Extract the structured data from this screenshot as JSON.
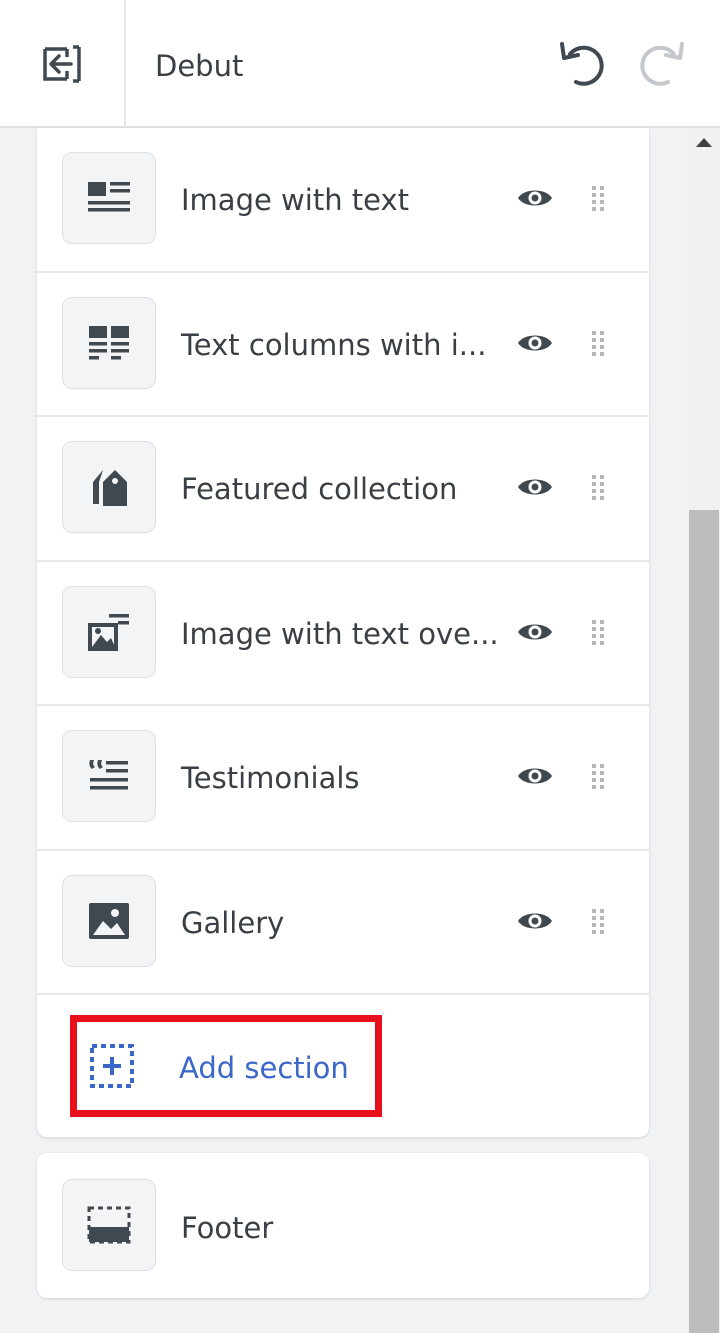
{
  "header": {
    "title": "Debut",
    "back_icon": "exit-icon",
    "undo_icon": "undo-icon",
    "redo_icon": "redo-icon"
  },
  "sections": [
    {
      "label": "Image with text",
      "icon": "image-with-text-icon"
    },
    {
      "label": "Text columns with i...",
      "icon": "text-columns-icon"
    },
    {
      "label": "Featured collection",
      "icon": "collection-tags-icon"
    },
    {
      "label": "Image with text ove...",
      "icon": "image-overlay-icon"
    },
    {
      "label": "Testimonials",
      "icon": "testimonials-quote-icon"
    },
    {
      "label": "Gallery",
      "icon": "gallery-image-icon"
    }
  ],
  "add_section": {
    "label": "Add section",
    "icon": "add-section-icon"
  },
  "footer": {
    "label": "Footer",
    "icon": "footer-layout-icon"
  },
  "colors": {
    "link_blue": "#3b67c9",
    "highlight_red": "#e8101a",
    "icon_gray": "#404850"
  }
}
